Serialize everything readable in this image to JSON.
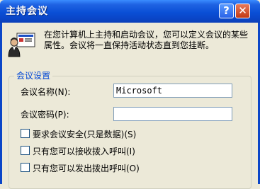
{
  "window": {
    "title": "主持会议",
    "help_glyph": "?",
    "close_glyph": "✕"
  },
  "intro": {
    "icon": "meeting-host-icon",
    "text": "在您计算机上主持和启动会议，您可以定义会议的某些属性。会议将一直保持活动状态直到您挂断。"
  },
  "settings": {
    "group_label": "会议设置",
    "name_label": "会议名称(N):",
    "name_value": "Microsoft",
    "password_label": "会议密码(P):",
    "password_value": "",
    "options": [
      {
        "label": "要求会议安全(只是数据)(S)",
        "checked": false
      },
      {
        "label": "只有您可以接收拨入呼叫(I)",
        "checked": false
      },
      {
        "label": "只有您可以发出拨出呼叫(O)",
        "checked": false
      }
    ]
  },
  "colors": {
    "title_bar": "#0a4fd6",
    "group_label": "#0046d5",
    "dialog_bg": "#ece9d8"
  }
}
